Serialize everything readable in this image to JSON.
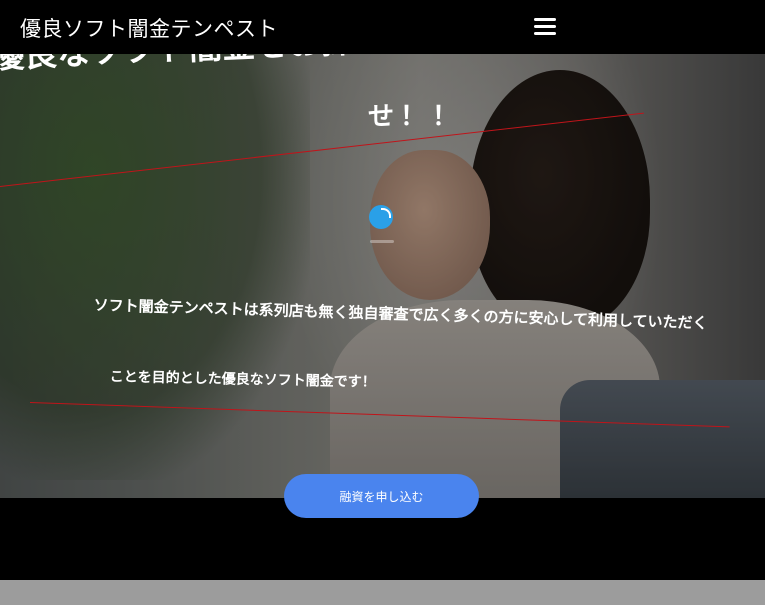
{
  "header": {
    "site_title": "優良ソフト闇金テンペスト",
    "menu_icon": "hamburger-menu-icon"
  },
  "hero": {
    "headline_line1": "優良なソフト闇金をお探しならテンペストにお任",
    "headline_line2": "せ！！",
    "body_line1": "ソフト闇金テンペストは系列店も無く独自審査で広く多くの方に安心して利用していただく",
    "body_line2": "ことを目的とした優良なソフト闇金です！",
    "cta_label": "融資を申し込む",
    "loader_icon": "loading-spinner-icon"
  },
  "colors": {
    "header_bg": "#000000",
    "cta_bg": "#4a84ee",
    "accent_line": "#c0141a",
    "loader": "#2aa0e8"
  }
}
